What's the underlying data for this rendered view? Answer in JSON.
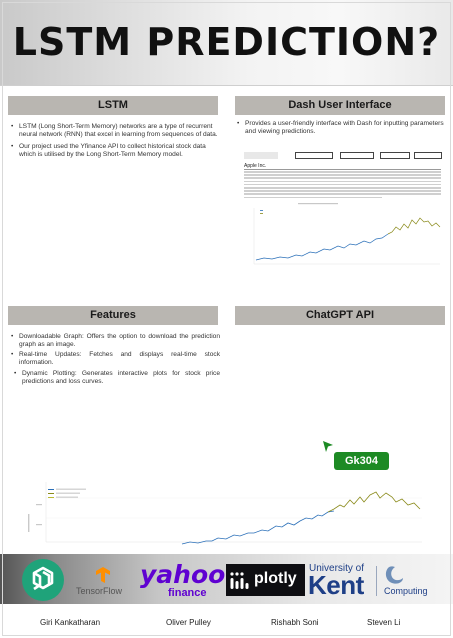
{
  "title": "LSTM PREDICTION?",
  "sections": {
    "lstm": {
      "heading": "LSTM",
      "bullets": [
        "LSTM (Long Short-Term Memory) networks are a type of recurrent neural network (RNN) that excel in learning from sequences of data.",
        "Our project used the Yfinance API to collect historical stock data which is utilised by the Long Short-Term Memory model."
      ]
    },
    "dash": {
      "heading": "Dash User Interface",
      "bullets": [
        "Provides a user-friendly interface with Dash for inputting parameters and viewing predictions."
      ],
      "screenshot_company": "Apple Inc."
    },
    "features": {
      "heading": "Features",
      "bullets": [
        "Downloadable Graph: Offers the option to download the prediction graph as an image.",
        "Real-time Updates: Fetches and displays real-time stock information.",
        "Dynamic Plotting: Generates interactive plots for stock price predictions and loss curves."
      ]
    },
    "chatgpt": {
      "heading": "ChatGPT API",
      "badge": "Gk304"
    }
  },
  "logos": {
    "tensorflow": "TensorFlow",
    "yahoo_top": "yahoo!",
    "yahoo_bottom": "finance",
    "plotly": "plotly",
    "kent_top": "University of",
    "kent_bottom": "Kent",
    "computing": "Computing"
  },
  "authors": [
    "Giri Kankatharan",
    "Oliver Pulley",
    "Rishabh Soni",
    "Steven Li"
  ],
  "colors": {
    "section_header": "#b9b6b1",
    "badge_green": "#1d8a24",
    "actual_price": "#2a6fb8",
    "predicted_price": "#8a8a1a",
    "yahoo_purple": "#5f01d1",
    "tensorflow_orange": "#ff8f00",
    "openai_green": "#1fa37a",
    "kent_blue": "#1e3f87"
  }
}
